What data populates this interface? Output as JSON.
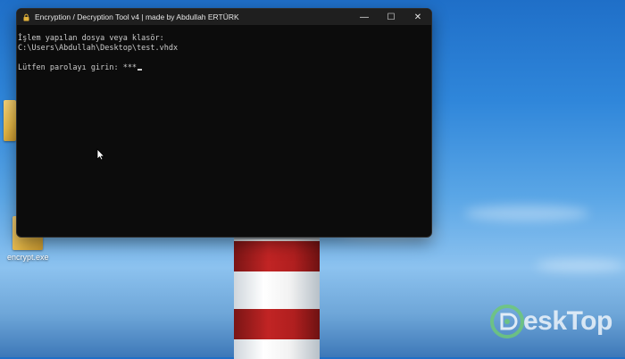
{
  "console_window": {
    "title": "Encryption / Decryption Tool v4 | made by Abdullah ERTÜRK",
    "lines": [
      "İşlem yapılan dosya veya klasör:",
      "C:\\Users\\Abdullah\\Desktop\\test.vhdx",
      "",
      "Lütfen parolayı girin: ***"
    ],
    "controls": {
      "minimize": "—",
      "maximize": "☐",
      "close": "✕"
    }
  },
  "desktop": {
    "icons": [
      {
        "label": "encrypt.exe"
      }
    ]
  },
  "watermark": {
    "text": "esk",
    "text2": "Top"
  },
  "colors": {
    "terminal_bg": "#0c0c0c",
    "titlebar_bg": "#1f1f1f",
    "terminal_text": "#cccccc",
    "sky": "#2f86da"
  }
}
